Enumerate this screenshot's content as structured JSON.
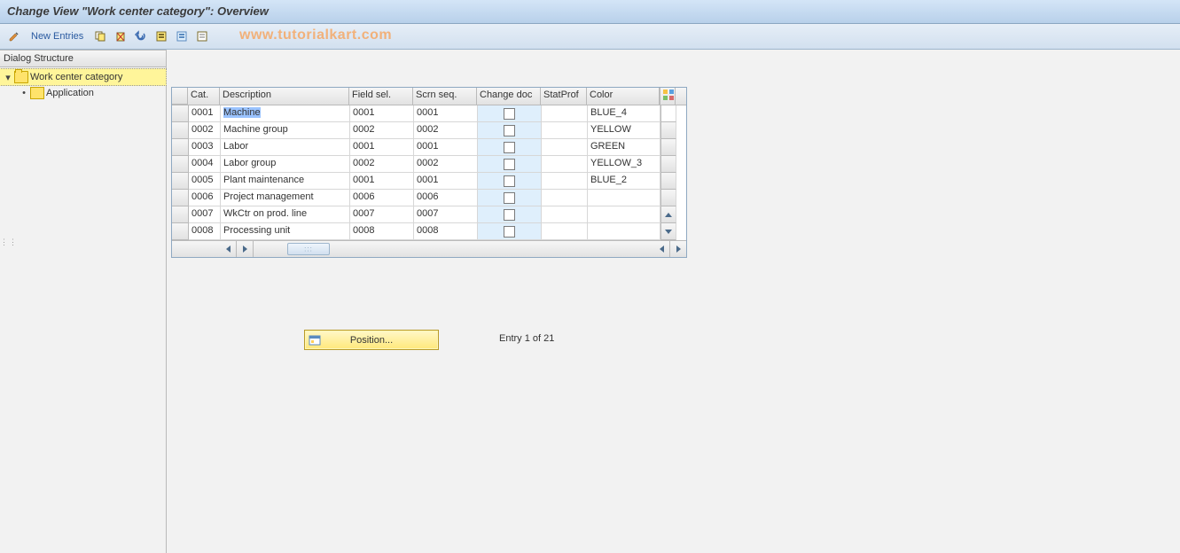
{
  "title": "Change View \"Work center category\": Overview",
  "watermark": "www.tutorialkart.com",
  "toolbar": {
    "new_entries": "New Entries"
  },
  "tree": {
    "header": "Dialog Structure",
    "root": "Work center category",
    "child": "Application"
  },
  "grid": {
    "headers": {
      "cat": "Cat.",
      "desc": "Description",
      "fld": "Field sel.",
      "scrn": "Scrn seq.",
      "chg": "Change doc",
      "stat": "StatProf",
      "color": "Color"
    },
    "rows": [
      {
        "cat": "0001",
        "desc": "Machine",
        "fld": "0001",
        "scrn": "0001",
        "color": "BLUE_4",
        "hl": true
      },
      {
        "cat": "0002",
        "desc": "Machine group",
        "fld": "0002",
        "scrn": "0002",
        "color": "YELLOW"
      },
      {
        "cat": "0003",
        "desc": "Labor",
        "fld": "0001",
        "scrn": "0001",
        "color": "GREEN"
      },
      {
        "cat": "0004",
        "desc": "Labor group",
        "fld": "0002",
        "scrn": "0002",
        "color": "YELLOW_3"
      },
      {
        "cat": "0005",
        "desc": "Plant maintenance",
        "fld": "0001",
        "scrn": "0001",
        "color": "BLUE_2"
      },
      {
        "cat": "0006",
        "desc": "Project management",
        "fld": "0006",
        "scrn": "0006",
        "color": ""
      },
      {
        "cat": "0007",
        "desc": "WkCtr on prod. line",
        "fld": "0007",
        "scrn": "0007",
        "color": ""
      },
      {
        "cat": "0008",
        "desc": "Processing unit",
        "fld": "0008",
        "scrn": "0008",
        "color": ""
      }
    ]
  },
  "position_button": "Position...",
  "entry_text": "Entry 1 of 21"
}
